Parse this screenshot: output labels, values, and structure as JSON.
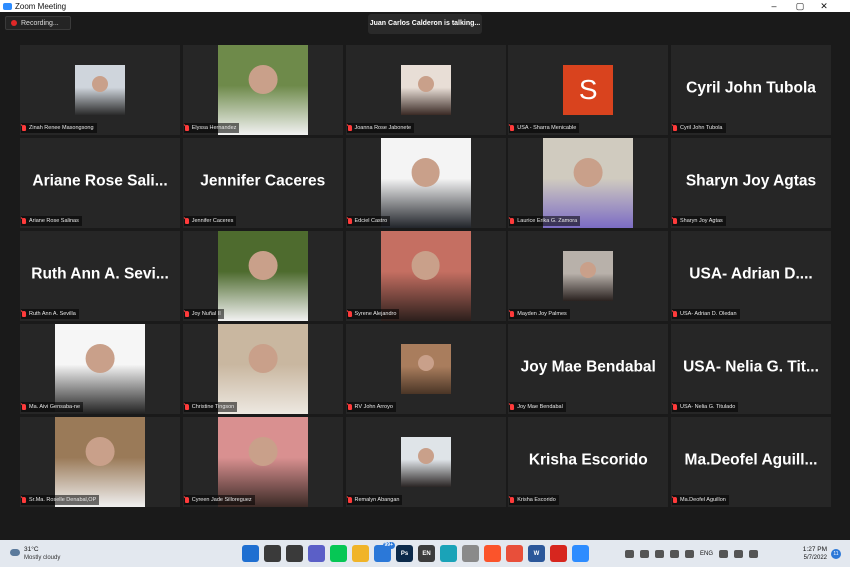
{
  "window": {
    "title": "Zoom Meeting"
  },
  "window_controls": {
    "minimize": "–",
    "maximize": "▢",
    "close": "✕"
  },
  "recording": {
    "label": "Recording..."
  },
  "active_speaker": {
    "text": "Juan Carlos Calderon is talking..."
  },
  "participants": [
    {
      "name": "Zinah Renee Masongsong",
      "video": "photo",
      "size": "s",
      "colors": [
        "#cfd5dc",
        "#2a2a2a"
      ]
    },
    {
      "name": "Elyssa Hernandez",
      "video": "photo",
      "size": "l",
      "colors": [
        "#6e8a4a",
        "#f2f2f2"
      ]
    },
    {
      "name": "Joanna Rose Jabonete",
      "video": "photo",
      "size": "s",
      "colors": [
        "#e8ded6",
        "#3a2a25"
      ]
    },
    {
      "name": "USA - Sharra Menicable",
      "video": "initial",
      "initial": "S",
      "colors": [
        "#d9431e"
      ]
    },
    {
      "name": "Cyril John Tubola",
      "video": "name",
      "display": "Cyril John Tubola"
    },
    {
      "name": "Ariane Rose Salinas",
      "video": "name",
      "display": "Ariane Rose Sali..."
    },
    {
      "name": "Jennifer Caceres",
      "video": "name",
      "display": "Jennifer Caceres"
    },
    {
      "name": "Edciel Castro",
      "video": "photo",
      "size": "l",
      "colors": [
        "#f4f4f4",
        "#22252b"
      ]
    },
    {
      "name": "Laurice Erika G. Zamora",
      "video": "photo",
      "size": "l",
      "colors": [
        "#d0cbbf",
        "#7c6cc4"
      ]
    },
    {
      "name": "Sharyn Joy Agtas",
      "video": "name",
      "display": "Sharyn Joy Agtas"
    },
    {
      "name": "Ruth Ann A. Sevilla",
      "video": "name",
      "display": "Ruth Ann A. Sevi..."
    },
    {
      "name": "Joy Nuñal II",
      "video": "photo",
      "size": "l",
      "colors": [
        "#4e6b2e",
        "#f2f2f2"
      ]
    },
    {
      "name": "Syrene Alejandro",
      "video": "photo",
      "size": "l",
      "colors": [
        "#c56f62",
        "#2c1f1c"
      ]
    },
    {
      "name": "Mayden Joy Palmes",
      "video": "photo",
      "size": "s",
      "colors": [
        "#b8b1aa",
        "#2a2220"
      ]
    },
    {
      "name": "USA- Adrian D. Oledan",
      "video": "name",
      "display": "USA- Adrian D...."
    },
    {
      "name": "Ma. Aivi Gensaba-ne",
      "video": "photo",
      "size": "l",
      "colors": [
        "#f6f6f6",
        "#222222"
      ]
    },
    {
      "name": "Christine Tingson",
      "video": "photo",
      "size": "l",
      "colors": [
        "#c9b7a0",
        "#ede8e1"
      ]
    },
    {
      "name": "RV John Arroyo",
      "video": "photo",
      "size": "s",
      "colors": [
        "#a97d5d",
        "#4a3526"
      ]
    },
    {
      "name": "Joy Mae Bendabal",
      "video": "name",
      "display": "Joy Mae Bendabal"
    },
    {
      "name": "USA- Nelia G. Titulado",
      "video": "name",
      "display": "USA- Nelia G. Tit..."
    },
    {
      "name": "Sr.Ma. Roselle Denabal,OP",
      "video": "photo",
      "size": "l",
      "colors": [
        "#9a7a58",
        "#f0f0f0"
      ]
    },
    {
      "name": "Cyreen Jade Silloreguez",
      "video": "photo",
      "size": "l",
      "colors": [
        "#d99090",
        "#3b2a26"
      ]
    },
    {
      "name": "Remalyn Abangan",
      "video": "photo",
      "size": "s",
      "colors": [
        "#dfe4e8",
        "#2a2524"
      ]
    },
    {
      "name": "Krisha Escorido",
      "video": "name",
      "display": "Krisha Escorido"
    },
    {
      "name": "Ma.Deofel Aguillon",
      "video": "name",
      "display": "Ma.Deofel  Aguill..."
    }
  ],
  "taskbar": {
    "weather": {
      "temp": "31°C",
      "condition": "Mostly cloudy"
    },
    "icons": [
      {
        "name": "windows-start-icon",
        "color": "#1f6fd1",
        "label": ""
      },
      {
        "name": "search-icon",
        "color": "#3a3a3a",
        "label": ""
      },
      {
        "name": "task-view-icon",
        "color": "#3a3a3a",
        "label": ""
      },
      {
        "name": "teams-chat-icon",
        "color": "#5b5fc7",
        "label": ""
      },
      {
        "name": "line-app-icon",
        "color": "#06c755",
        "label": ""
      },
      {
        "name": "file-explorer-icon",
        "color": "#f0b429",
        "label": ""
      },
      {
        "name": "store-icon",
        "color": "#2b78d8",
        "label": "99+"
      },
      {
        "name": "photoshop-icon",
        "color": "#0c2a4a",
        "label": "Ps"
      },
      {
        "name": "en-app-icon",
        "color": "#3c3c3c",
        "label": "EN"
      },
      {
        "name": "edge-icon",
        "color": "#1aa3b8",
        "label": ""
      },
      {
        "name": "app-icon",
        "color": "#8a8a8a",
        "label": ""
      },
      {
        "name": "brave-icon",
        "color": "#fb542b",
        "label": ""
      },
      {
        "name": "chrome-icon",
        "color": "#e84f3a",
        "label": ""
      },
      {
        "name": "word-icon",
        "color": "#2b579a",
        "label": "W"
      },
      {
        "name": "acrobat-icon",
        "color": "#d7261e",
        "label": ""
      },
      {
        "name": "zoom-icon",
        "color": "#2d8cff",
        "label": ""
      }
    ],
    "tray": {
      "lang": "ENG"
    },
    "clock": {
      "time": "1:27 PM",
      "date": "5/7/2022"
    },
    "notifications": "11"
  }
}
